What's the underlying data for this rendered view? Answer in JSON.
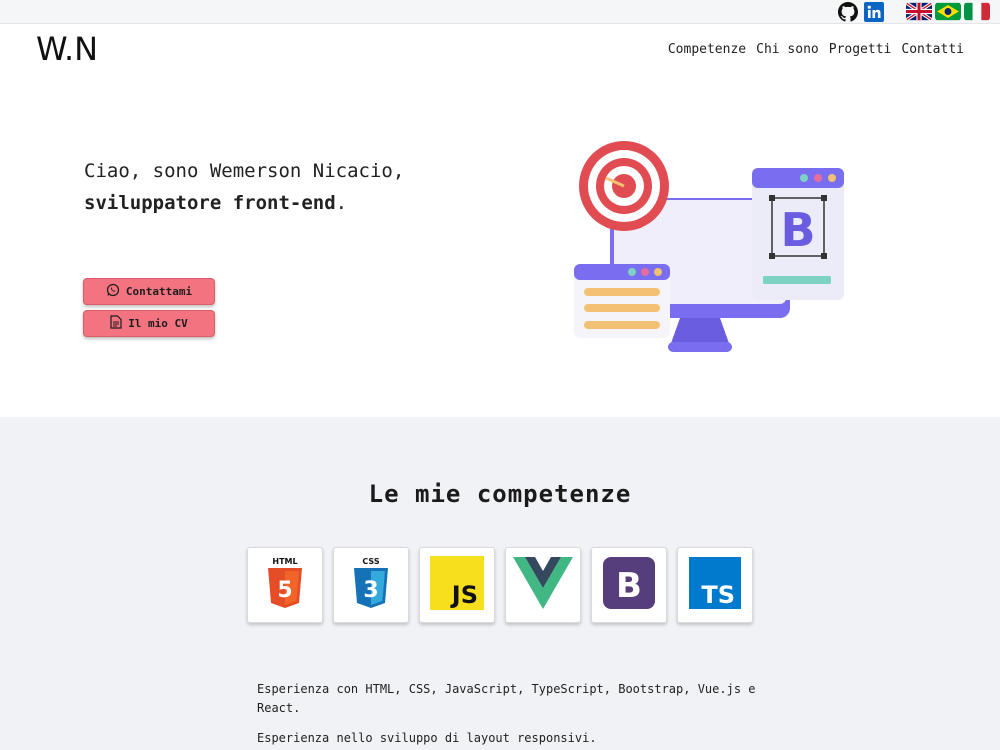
{
  "header": {
    "logo": "W.N",
    "nav": [
      "Competenze",
      "Chi sono",
      "Progetti",
      "Contatti"
    ]
  },
  "topbar": {
    "social_icons": [
      "github-icon",
      "linkedin-icon"
    ],
    "languages": [
      "english-flag",
      "brazil-flag",
      "italy-flag"
    ]
  },
  "hero": {
    "line1": "Ciao, sono Wemerson Nicacio,",
    "line2_bold": "sviluppatore front-end",
    "line2_tail": ".",
    "contact_button": "Contattami",
    "cv_button": "Il mio CV",
    "illustration_letter": "B"
  },
  "skills": {
    "title": "Le mie competenze",
    "items": [
      {
        "name": "HTML",
        "badge": "5",
        "color": "#e44d26"
      },
      {
        "name": "CSS",
        "badge": "3",
        "color": "#1572b6"
      },
      {
        "name": "JS",
        "color": "#f7df1e"
      },
      {
        "name": "Vue",
        "color": "#41b883"
      },
      {
        "name": "B",
        "color": "#563d7c"
      },
      {
        "name": "TS",
        "color": "#007acc"
      }
    ],
    "description1": "Esperienza con HTML, CSS, JavaScript, TypeScript, Bootstrap, Vue.js e React.",
    "description2": "Esperienza nello sviluppo di layout responsivi."
  },
  "colors": {
    "accent": "#f47380",
    "skills_bg": "#f1f2f6",
    "purple": "#7a6ef0"
  }
}
